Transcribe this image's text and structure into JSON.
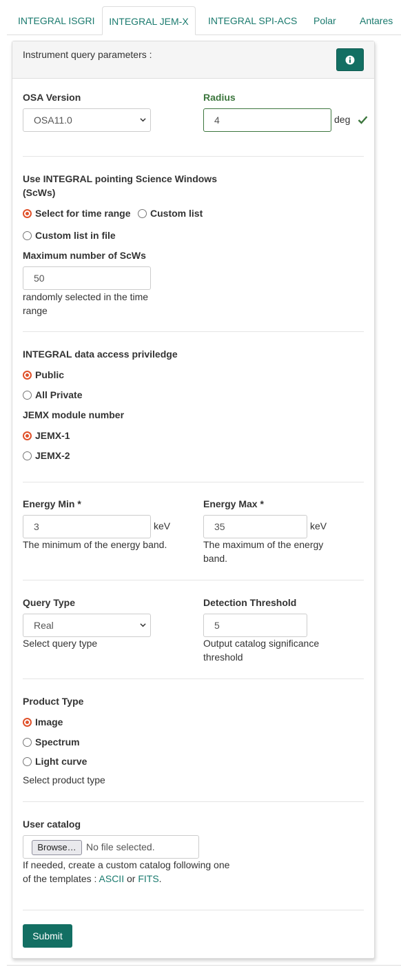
{
  "tabs": [
    {
      "label": "INTEGRAL ISGRI"
    },
    {
      "label": "INTEGRAL JEM-X"
    },
    {
      "label": "INTEGRAL SPI-ACS"
    },
    {
      "label": "Polar"
    },
    {
      "label": "Antares"
    }
  ],
  "active_tab": "INTEGRAL JEM-X",
  "panel": {
    "header_text": "Instrument query parameters :",
    "info_icon": "info-circle-icon"
  },
  "osa": {
    "label": "OSA Version",
    "value": "OSA11.0"
  },
  "radius": {
    "label": "Radius",
    "value": "4",
    "unit": "deg",
    "valid_icon": "checkmark-icon"
  },
  "scw": {
    "label_line1": "Use INTEGRAL pointing Science Windows",
    "label_line2": "(ScWs)",
    "options": [
      {
        "label": "Select for time range",
        "selected": true
      },
      {
        "label": "Custom list",
        "selected": false
      },
      {
        "label": "Custom list in file",
        "selected": false
      }
    ],
    "max_label": "Maximum number of ScWs",
    "max_value": "50",
    "max_help_line1": "randomly selected in the time",
    "max_help_line2": "range"
  },
  "access": {
    "label": "INTEGRAL data access priviledge",
    "options": [
      {
        "label": "Public",
        "selected": true
      },
      {
        "label": "All Private",
        "selected": false
      }
    ]
  },
  "jemx": {
    "label": "JEMX module number",
    "options": [
      {
        "label": "JEMX-1",
        "selected": true
      },
      {
        "label": "JEMX-2",
        "selected": false
      }
    ]
  },
  "energy_min": {
    "label": "Energy Min *",
    "value": "3",
    "unit": "keV",
    "help": "The minimum of the energy band."
  },
  "energy_max": {
    "label": "Energy Max *",
    "value": "35",
    "unit": "keV",
    "help_line1": "The maximum of the energy",
    "help_line2": "band."
  },
  "query_type": {
    "label": "Query Type",
    "value": "Real",
    "help": "Select query type"
  },
  "detection": {
    "label": "Detection Threshold",
    "value": "5",
    "help_line1": "Output catalog significance",
    "help_line2": "threshold"
  },
  "product": {
    "label": "Product Type",
    "options": [
      {
        "label": "Image",
        "selected": true
      },
      {
        "label": "Spectrum",
        "selected": false
      },
      {
        "label": "Light curve",
        "selected": false
      }
    ],
    "help": "Select product type"
  },
  "catalog": {
    "label": "User catalog",
    "browse_label": "Browse…",
    "no_file": "No file selected.",
    "help_line1": "If needed, create a custom catalog following one",
    "help_line2_prefix": "of the templates : ",
    "link_ascii": "ASCII",
    "or": " or ",
    "link_fits": "FITS",
    "suffix": "."
  },
  "submit_label": "Submit",
  "colors": {
    "accent": "#136f63",
    "link": "#1a7a6e",
    "radio_selected": "#e0522b",
    "valid_green": "#3c763d"
  }
}
